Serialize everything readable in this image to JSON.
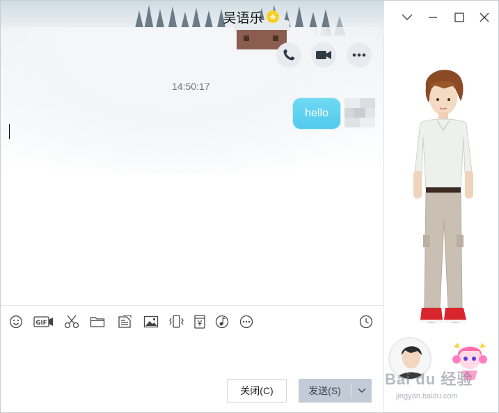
{
  "window": {
    "title": "吴语乐",
    "title_badge_icon": "vip-star-icon",
    "controls": [
      "chevron-down-icon",
      "minimize-icon",
      "maximize-icon",
      "close-icon"
    ]
  },
  "call_actions": [
    "phone-icon",
    "video-icon",
    "more-icon"
  ],
  "conversation": {
    "timestamp": "14:50:17",
    "messages": [
      {
        "sender": "me",
        "text": "hello"
      }
    ]
  },
  "toolbar": {
    "tools": [
      "emoji-icon",
      "gif-icon",
      "scissors-icon",
      "folder-icon",
      "doc-icon",
      "image-icon",
      "shake-icon",
      "red-packet-icon",
      "music-icon",
      "more-circle-icon"
    ],
    "history_icon": "clock-icon"
  },
  "actions": {
    "close_label": "关闭(C)",
    "send_label": "发送(S)"
  },
  "watermark": {
    "brand": "Bai du 经验",
    "url": "jingyan.baidu.com"
  },
  "colors": {
    "bubble": "#5ccbed",
    "send_button": "#c3cbd6",
    "call_button_bg": "#e7eaee"
  }
}
